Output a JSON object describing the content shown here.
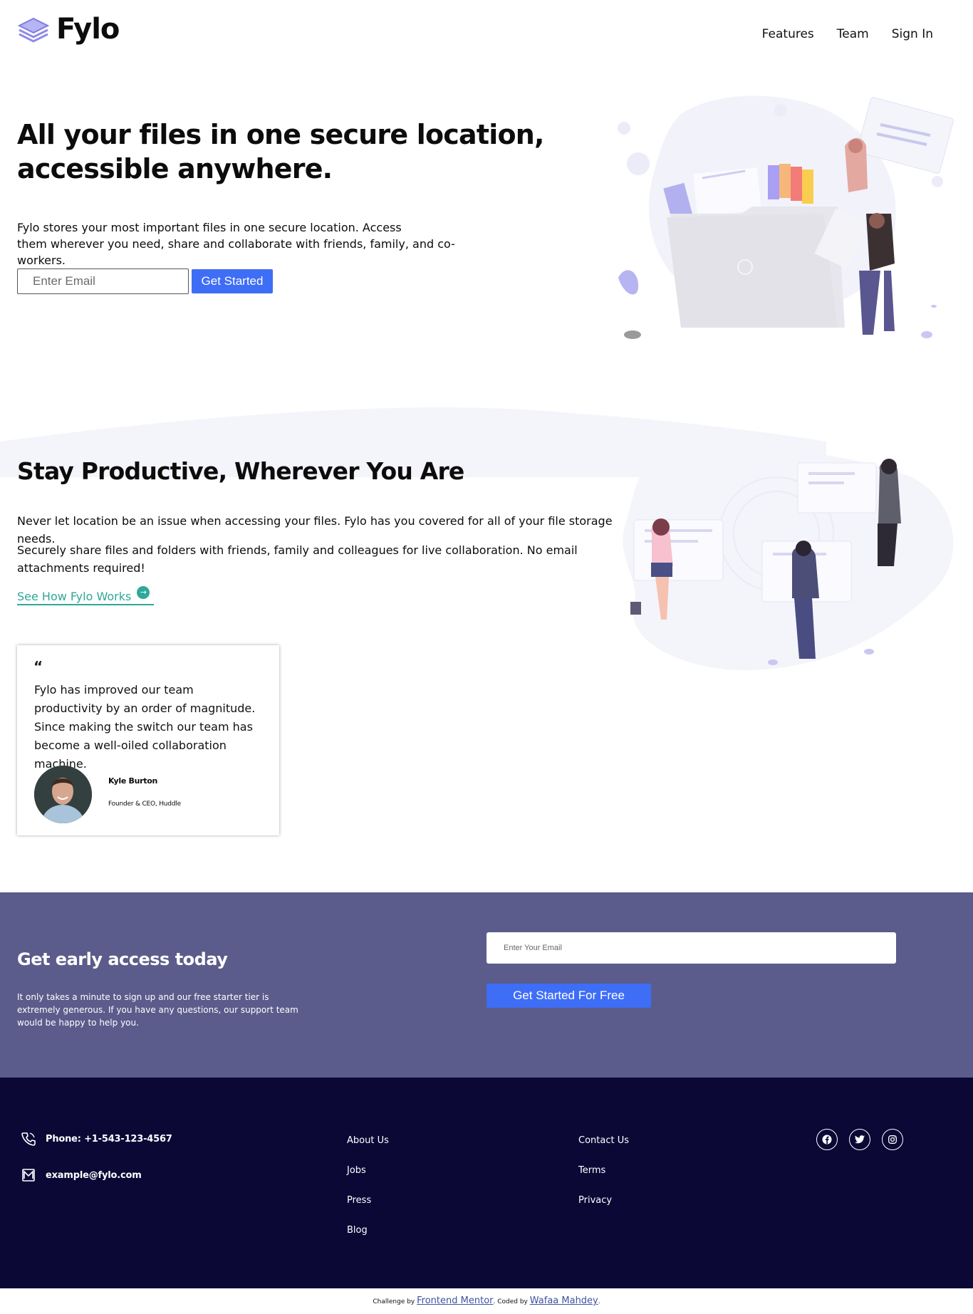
{
  "brand": {
    "name": "Fylo"
  },
  "nav": {
    "features": "Features",
    "team": "Team",
    "signin": "Sign In"
  },
  "hero": {
    "title": "All your files in one secure location, accessible anywhere.",
    "text_line1": "Fylo stores your most important files in one secure location. Access",
    "text_line2": "them wherever you need, share and collaborate with friends, family, and co-workers.",
    "email_placeholder": "Enter Email",
    "button": "Get Started"
  },
  "productive": {
    "title": "Stay Productive, Wherever You Are",
    "p1": "Never let location be an issue when accessing your files. Fylo has you covered for all of your file storage needs.",
    "p2": "Securely share files and folders with friends, family and colleagues for live collaboration. No email attachments required!",
    "link": "See How Fylo Works"
  },
  "testimonial": {
    "quote_mark": "“",
    "text": "Fylo has improved our team productivity by an order of magnitude. Since making the switch our team has become a well-oiled collaboration machine.",
    "name": "Kyle Burton",
    "role": "Founder & CEO, Huddle"
  },
  "cta": {
    "title": "Get early access today",
    "text": "It only takes a minute to sign up and our free starter tier is extremely generous. If you have any questions, our support team would be happy to help you.",
    "email_placeholder": "Enter Your Email",
    "button": "Get Started For Free"
  },
  "footer": {
    "phone": "Phone: +1-543-123-4567",
    "email": "example@fylo.com",
    "col1": [
      "About Us",
      "Jobs",
      "Press",
      "Blog"
    ],
    "col2": [
      "Contact Us",
      "Terms",
      "Privacy"
    ],
    "icons": [
      "facebook-icon",
      "twitter-icon",
      "instagram-icon"
    ]
  },
  "attribution": {
    "prefix": "Challenge by",
    "link1": "Frontend Mentor",
    "middle": ". Coded by",
    "link2": "Wafaa Mahdey",
    "suffix": "."
  },
  "colors": {
    "accent": "#3e6df6",
    "cta_bg": "#5b5c8b",
    "footer_bg": "#0b0836",
    "link": "#2ea899"
  }
}
